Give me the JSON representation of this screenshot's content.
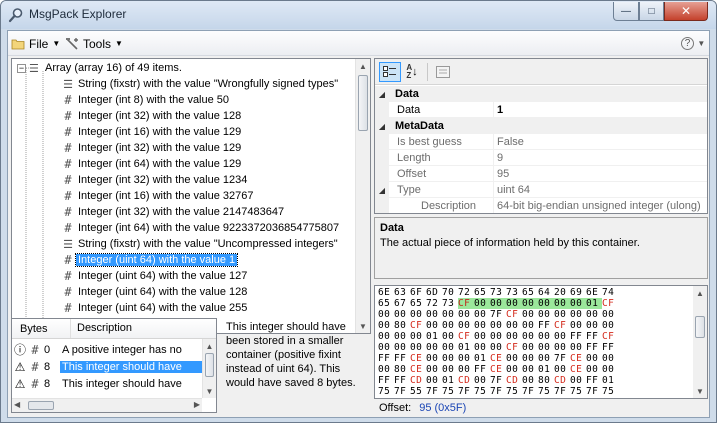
{
  "window": {
    "title": "MsgPack Explorer",
    "controls": {
      "minimize": "—",
      "maximize": "□",
      "close": "✕"
    }
  },
  "menu": {
    "file_label": "File",
    "tools_label": "Tools",
    "help_label": "?"
  },
  "tree": {
    "root_label": "Array (array 16) of 49 items.",
    "items": [
      {
        "label": "String (fixstr) with the value \"Wrongfully signed types\""
      },
      {
        "label": "Integer (int 8) with the value 50"
      },
      {
        "label": "Integer (int 32) with the value 128"
      },
      {
        "label": "Integer (int 16) with the value 129"
      },
      {
        "label": "Integer (int 32) with the value 129"
      },
      {
        "label": "Integer (int 64) with the value 129"
      },
      {
        "label": "Integer (int 32) with the value 1234"
      },
      {
        "label": "Integer (int 16) with the value 32767"
      },
      {
        "label": "Integer (int 32) with the value 2147483647"
      },
      {
        "label": "Integer (int 64) with the value 9223372036854775807"
      },
      {
        "label": "String (fixstr) with the value \"Uncompressed integers\""
      },
      {
        "label": "Integer (uint 64) with the value 1"
      },
      {
        "label": "Integer (uint 64) with the value 127"
      },
      {
        "label": "Integer (uint 64) with the value 128"
      },
      {
        "label": "Integer (uint 64) with the value 255"
      }
    ],
    "selected_index": 11
  },
  "issues": {
    "col_bytes": "Bytes",
    "col_description": "Description",
    "rows": [
      {
        "icon": "info",
        "bytes": "0",
        "description": "A positive integer has no"
      },
      {
        "icon": "warning",
        "bytes": "8",
        "description": "This integer should have"
      },
      {
        "icon": "warning",
        "bytes": "8",
        "description": "This integer should have"
      }
    ],
    "selected_index": 1
  },
  "issue_detail": "This integer should have been stored in a smaller container (positive fixint instead of uint 64). This would have saved 8 bytes.",
  "propgrid": {
    "categories": [
      {
        "name": "Data",
        "rows": [
          {
            "name": "Data",
            "value": "1",
            "bold": true
          }
        ]
      },
      {
        "name": "MetaData",
        "rows": [
          {
            "name": "Is best guess",
            "value": "False"
          },
          {
            "name": "Length",
            "value": "9"
          },
          {
            "name": "Offset",
            "value": "95"
          },
          {
            "name": "Type",
            "value": "uint 64",
            "expandable": true
          },
          {
            "name": "Description",
            "value": "64-bit big-endian unsigned integer (ulong)",
            "indent": true
          }
        ]
      }
    ]
  },
  "description_pane": {
    "title": "Data",
    "body": "The actual piece of information held by this container."
  },
  "hex": {
    "lines": [
      "6E 63 6F 6D 70 72 65 73 73 65 64 20 69 6E 74",
      "65 67 65 72 73 CF 00 00 00 00 00 00 00 01 CF",
      "00 00 00 00 00 00 00 7F CF 00 00 00 00 00 00",
      "00 80 CF 00 00 00 00 00 00 00 FF CF 00 00 00",
      "00 00 00 01 00 CF 00 00 00 00 00 00 FF FF CF",
      "00 00 00 00 00 01 00 00 CF 00 00 00 00 FF FF",
      "FF FF CE 00 00 00 01 CE 00 00 00 7F CE 00 00",
      "00 80 CE 00 00 00 FF CE 00 00 01 00 CE 00 00",
      "FF FF CD 00 01 CD 00 7F CD 00 80 CD 00 FF 01",
      "75 7F 55 7F 75 7F 75 7F 75 7F 75 7F 75 7F 75"
    ],
    "highlight_line": 1,
    "highlight_start": 5,
    "highlight_end": 13,
    "red_value": "CF|CE|CD",
    "colors": {
      "red": "#d42a1c",
      "highlight": "#9be79b"
    }
  },
  "offset": {
    "label": "Offset:",
    "value": "95 (0x5F)"
  }
}
